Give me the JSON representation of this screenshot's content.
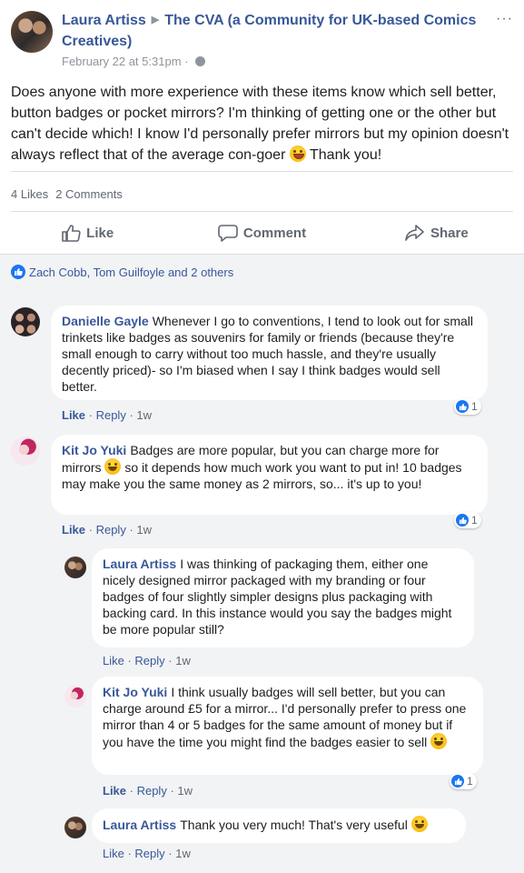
{
  "post": {
    "author": "Laura Artiss",
    "group": "The CVA (a Community for UK-based Comics Creatives)",
    "timestamp": "February 22 at 5:31pm",
    "more_icon": "···",
    "body_before_emoji": "Does anyone with more experience with these items know which sell better, button badges or pocket mirrors? I'm thinking of getting one or the other but can't decide which! I know I'd personally prefer mirrors but my opinion doesn't always reflect that of the average con-goer ",
    "body_after_emoji": " Thank you!",
    "likes": "4 Likes",
    "comments_count": "2 Comments"
  },
  "actions": {
    "like": "Like",
    "comment": "Comment",
    "share": "Share"
  },
  "reactions_summary": "Zach Cobb, Tom Guilfoyle and 2 others",
  "comments": [
    {
      "author": "Danielle Gayle",
      "text": "Whenever I go to conventions, I tend to look out for small trinkets like badges as souvenirs for family or friends (because they're small enough to carry without too much hassle, and they're usually decently priced)- so I'm biased when I say I think badges would sell better.",
      "like": "Like",
      "reply": "Reply",
      "time": "1w",
      "like_count": "1"
    },
    {
      "author": "Kit Jo Yuki",
      "text_before_emoji": "Badges are more popular, but you can charge more for mirrors ",
      "text_after_emoji": " so it depends how much work you want to put in! 10 badges may make you the same money as 2 mirrors, so... it's up to you!",
      "like": "Like",
      "reply": "Reply",
      "time": "1w",
      "like_count": "1"
    },
    {
      "author": "Laura Artiss",
      "text": "I was thinking of packaging them, either one nicely designed mirror packaged with my branding or four badges of four slightly simpler designs plus packaging with backing card. In this instance would you say the badges might be more popular still?",
      "like": "Like",
      "reply": "Reply",
      "time": "1w"
    },
    {
      "author": "Kit Jo Yuki",
      "text": "I think usually badges will sell better, but you can charge around £5 for a mirror... I'd personally prefer to press one mirror than 4 or 5 badges for the same amount of money but if you have the time you might find the badges easier to sell ",
      "like": "Like",
      "reply": "Reply",
      "time": "1w",
      "like_count": "1"
    },
    {
      "author": "Laura Artiss",
      "text": "Thank you very much! That's very useful ",
      "like": "Like",
      "reply": "Reply",
      "time": "1w"
    }
  ],
  "colors": {
    "link": "#385898",
    "secondary": "#606770",
    "background": "#f2f3f5",
    "like_blue": "#1877f2"
  }
}
